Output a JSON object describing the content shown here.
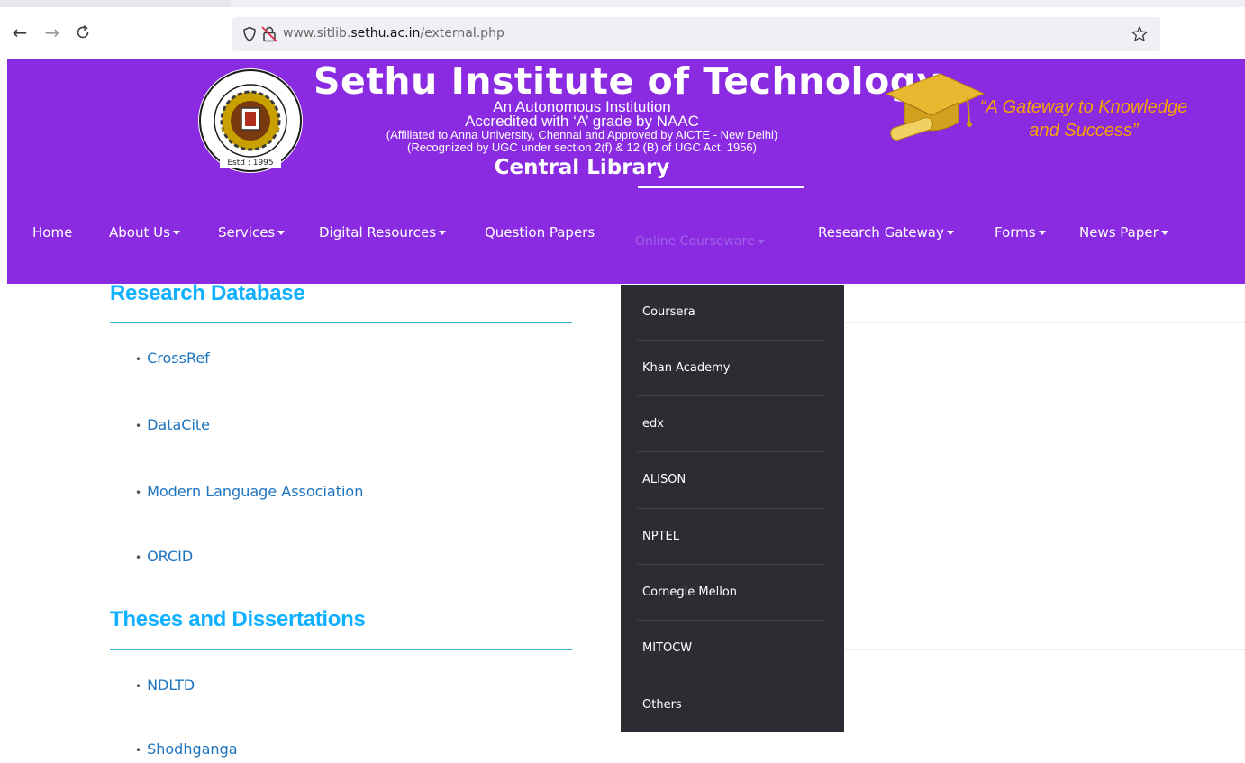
{
  "browser": {
    "url_prefix": "www.sitlib.",
    "url_domain": "sethu.ac.in",
    "url_path": "/external.php"
  },
  "header": {
    "institution_name": "Sethu Institute of Technology",
    "line1": "An Autonomous Institution",
    "line2": "Accredited with ‘A’ grade by NAAC",
    "line3": "(Affiliated to Anna University, Chennai and Approved by AICTE - New Delhi)",
    "line4": "(Recognized by UGC under section 2(f) & 12 (B) of UGC Act, 1956)",
    "library": "Central Library",
    "seal_text": "Estd : 1995",
    "tagline_line1": "“A Gateway to Knowledge",
    "tagline_line2": "and Success”",
    "tagline_color": "#f4a300",
    "brand_color": "#8a2be2"
  },
  "nav": {
    "home": "Home",
    "about": "About Us",
    "services": "Services",
    "digital": "Digital Resources",
    "question_papers": "Question Papers",
    "online": "Online Courseware",
    "research": "Research Gateway",
    "forms": "Forms",
    "newspaper": "News Paper"
  },
  "dropdown": {
    "items": [
      "Coursera",
      "Khan Academy",
      "edx",
      "ALISON",
      "NPTEL",
      "Cornegie Mellon",
      "MITOCW",
      "Others"
    ]
  },
  "content": {
    "research_db": {
      "heading": "Research Database",
      "links": [
        "CrossRef",
        "DataCite",
        "Modern Language Association",
        "ORCID"
      ]
    },
    "theses": {
      "heading": "Theses and Dissertations",
      "links": [
        "NDLTD",
        "Shodhganga"
      ]
    },
    "bullet": "•"
  }
}
